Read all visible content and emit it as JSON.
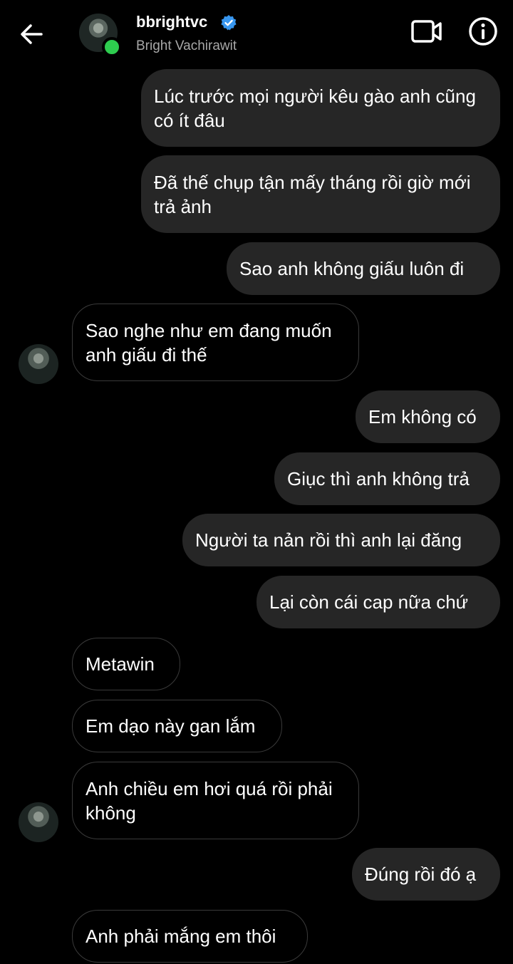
{
  "header": {
    "username": "bbrightvc",
    "subtitle": "Bright Vachirawit"
  },
  "messages": [
    {
      "from": "me",
      "text": "Lúc trước mọi người kêu gào anh cũng có ít đâu"
    },
    {
      "from": "me",
      "text": "Đã thế chụp tận mấy tháng rồi giờ mới trả ảnh"
    },
    {
      "from": "me",
      "text": "Sao anh không giấu luôn đi"
    },
    {
      "from": "them",
      "text": "Sao nghe như em đang muốn anh giấu đi thế"
    },
    {
      "from": "me",
      "text": "Em không có"
    },
    {
      "from": "me",
      "text": "Giục thì anh không trả"
    },
    {
      "from": "me",
      "text": "Người ta nản rồi thì anh lại đăng"
    },
    {
      "from": "me",
      "text": "Lại còn cái cap nữa chứ"
    },
    {
      "from": "them",
      "text": "Metawin"
    },
    {
      "from": "them",
      "text": "Em dạo này gan lắm"
    },
    {
      "from": "them",
      "text": "Anh chiều em hơi quá rồi phải không"
    },
    {
      "from": "me",
      "text": "Đúng rồi đó ạ"
    },
    {
      "from": "them",
      "text": "Anh phải mắng em thôi"
    }
  ],
  "icons": {
    "back": "arrow-left-icon",
    "verified": "verified-badge-icon",
    "video": "video-camera-icon",
    "info": "info-icon"
  },
  "colors": {
    "background": "#000000",
    "my_bubble": "#262626",
    "their_bubble_border": "#3a3a3a",
    "verified": "#3897f0",
    "online": "#2ecc4f"
  }
}
